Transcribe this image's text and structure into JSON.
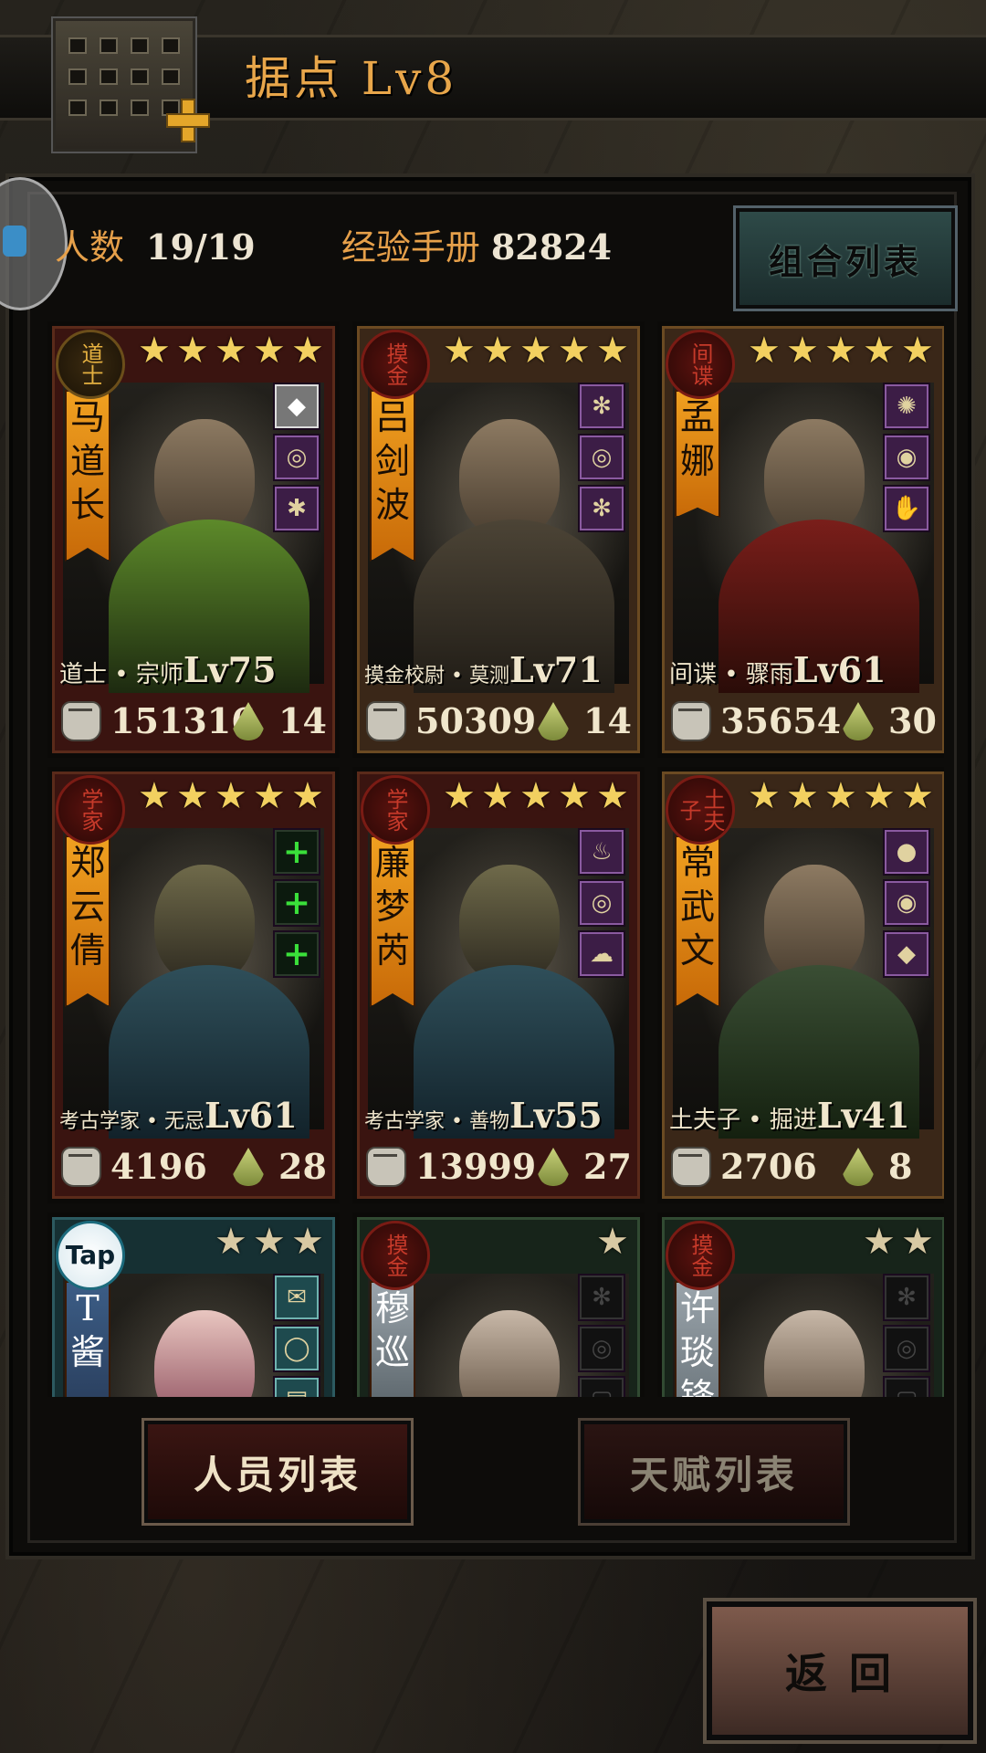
{
  "header": {
    "title": "据点  Lv8"
  },
  "stats": {
    "people_label": "人数",
    "people_value": "19/19",
    "exp_label": "经验手册",
    "exp_value": "82824"
  },
  "buttons": {
    "combo_list": "组合列表",
    "people_list": "人员列表",
    "talent_list": "天赋列表",
    "back": "返 回"
  },
  "cards": [
    {
      "seal": "道士",
      "name": "马道长",
      "stars": 5,
      "cls": "道士 • 宗师",
      "lv": "Lv75",
      "power": "151316",
      "rank": "14"
    },
    {
      "seal": "摸金",
      "name": "吕剑波",
      "stars": 5,
      "cls": "摸金校尉 • 莫测",
      "lv": "Lv71",
      "power": "50309",
      "rank": "14"
    },
    {
      "seal": "间谍",
      "name": "孟娜",
      "stars": 5,
      "cls": "间谍 • 骤雨",
      "lv": "Lv61",
      "power": "35654",
      "rank": "30"
    },
    {
      "seal": "学家",
      "name": "郑云倩",
      "stars": 5,
      "cls": "考古学家 • 无忌",
      "lv": "Lv61",
      "power": "4196",
      "rank": "28"
    },
    {
      "seal": "学家",
      "name": "廉梦芮",
      "stars": 5,
      "cls": "考古学家 • 善物",
      "lv": "Lv55",
      "power": "13999",
      "rank": "27"
    },
    {
      "seal": "土夫子",
      "name": "常武文",
      "stars": 5,
      "cls": "土夫子 • 掘进",
      "lv": "Lv41",
      "power": "2706",
      "rank": "8"
    },
    {
      "seal": "Tap",
      "name": "T酱",
      "stars": 3
    },
    {
      "seal": "摸金",
      "name": "穆巡",
      "stars": 1
    },
    {
      "seal": "摸金",
      "name": "许琰锋",
      "stars": 2
    }
  ],
  "icons": {
    "star": "star-icon",
    "fist": "fist-icon",
    "drop": "drop-icon",
    "plus": "plus-icon"
  },
  "colors": {
    "accent": "#e8a64a",
    "banner": "#f0a020",
    "equip_add": "#3adf3a"
  }
}
